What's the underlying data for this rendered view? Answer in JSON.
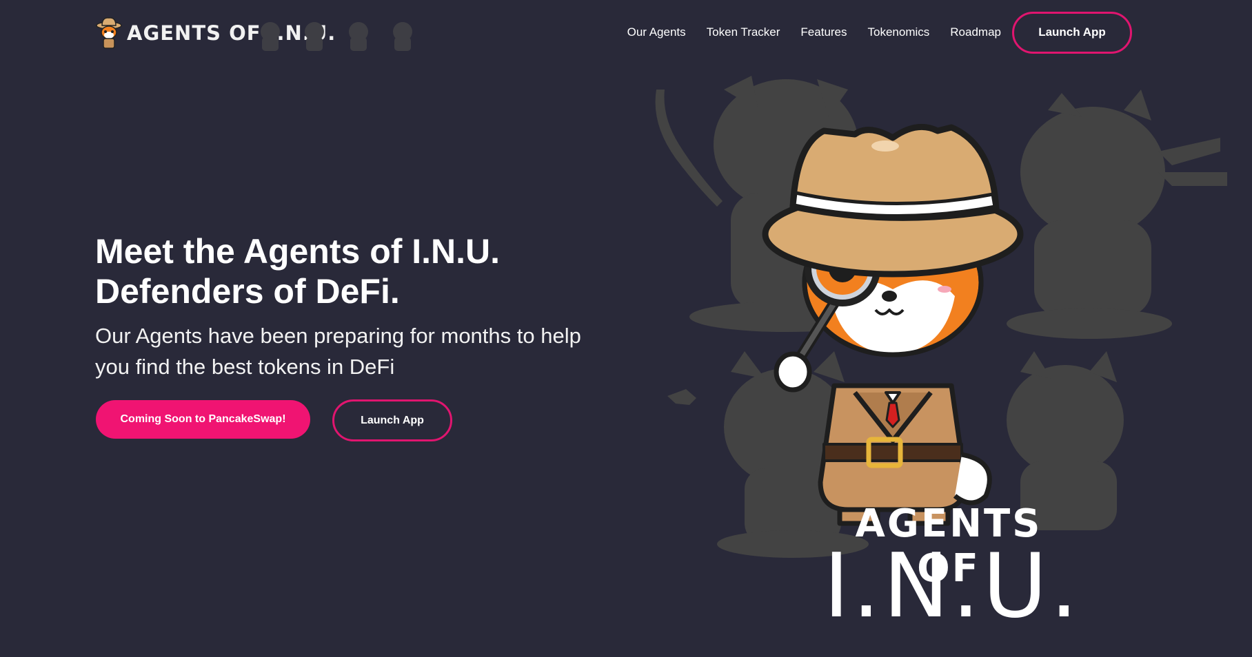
{
  "nav": {
    "logo_text": "AGENTS OF I.N.U.",
    "links": [
      {
        "label": "Our Agents"
      },
      {
        "label": "Token Tracker"
      },
      {
        "label": "Features"
      },
      {
        "label": "Tokenomics"
      },
      {
        "label": "Roadmap"
      }
    ],
    "cta_label": "Launch App"
  },
  "hero": {
    "title_line1": "Meet the Agents of I.N.U.",
    "title_line2": "Defenders of DeFi.",
    "subtitle": "Our Agents have been preparing for months to help you find the best tokens in DeFi",
    "primary_button": "Coming Soon to PancakeSwap!",
    "secondary_button": "Launch App"
  },
  "art": {
    "brand_line1": "AGENTS OF",
    "brand_line2": "I.N.U."
  },
  "colors": {
    "background": "#292939",
    "accent": "#f01472",
    "silhouette": "#424242",
    "hat": "#d9ab72",
    "fur": "#f2801f"
  }
}
